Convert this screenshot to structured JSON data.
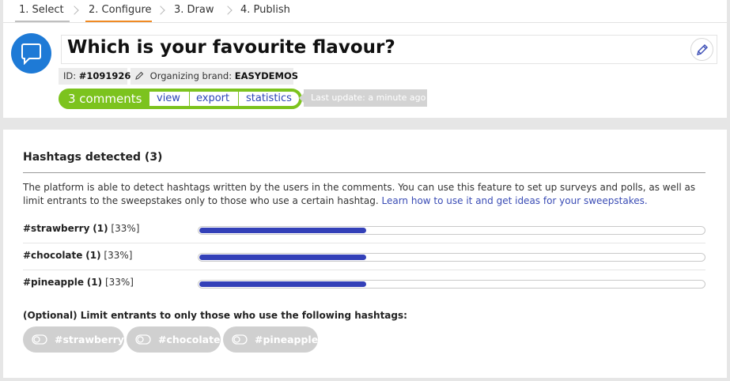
{
  "steps": [
    {
      "label": "1. Select"
    },
    {
      "label": "2. Configure"
    },
    {
      "label": "3. Draw"
    },
    {
      "label": "4. Publish"
    }
  ],
  "header": {
    "title": "Which is your favourite flavour?",
    "id_label": "ID:",
    "id_value": "#1091926",
    "brand_label": "Organizing brand:",
    "brand_value": "EASYDEMOS",
    "comments_count": "3 comments",
    "links": {
      "view": "view",
      "export": "export",
      "statistics": "statistics"
    },
    "last_update": "Last update: a minute ago"
  },
  "hashtags": {
    "title": "Hashtags detected (3)",
    "description": "The platform is able to detect hashtags written by the users in the comments. You can use this feature to set up surveys and polls, as well as limit entrants to the sweepstakes only to those who use a certain hashtag.",
    "learn_link": "Learn how to use it and get ideas for your sweepstakes.",
    "items": [
      {
        "tag": "#strawberry",
        "count": "(1)",
        "percent_label": "[33%]",
        "fraction": 0.33
      },
      {
        "tag": "#chocolate",
        "count": "(1)",
        "percent_label": "[33%]",
        "fraction": 0.33
      },
      {
        "tag": "#pineapple",
        "count": "(1)",
        "percent_label": "[33%]",
        "fraction": 0.33
      }
    ],
    "optional_label": "(Optional) Limit entrants to only those who use the following hashtags:",
    "toggles": [
      {
        "label": "#strawberry",
        "on": false
      },
      {
        "label": "#chocolate",
        "on": false
      },
      {
        "label": "#pineapple",
        "on": false
      }
    ]
  },
  "colors": {
    "accent_green": "#7cc31e",
    "avatar_blue": "#1e7ad6",
    "bar_blue": "#3340b8",
    "step_active": "#f08a24"
  }
}
